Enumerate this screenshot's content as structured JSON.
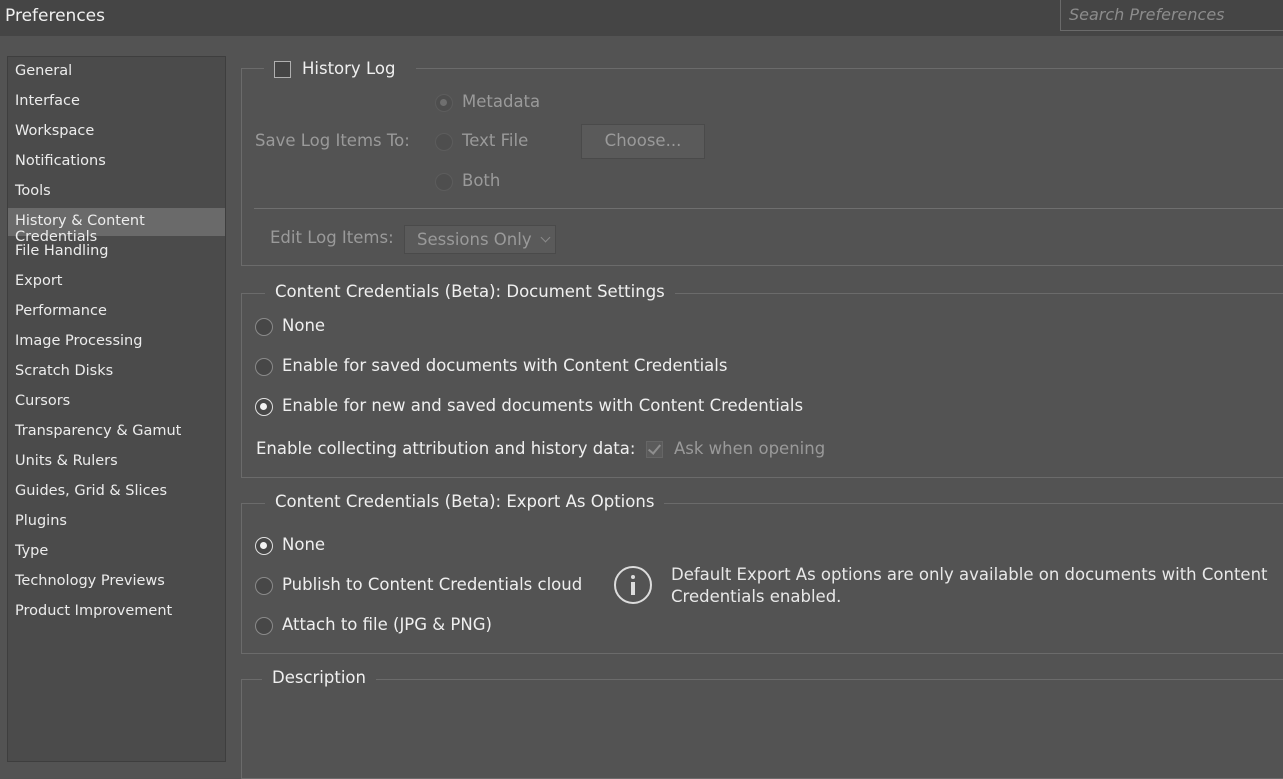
{
  "window": {
    "title": "Preferences"
  },
  "search": {
    "placeholder": "Search Preferences"
  },
  "sidebar": {
    "items": [
      {
        "label": "General"
      },
      {
        "label": "Interface"
      },
      {
        "label": "Workspace"
      },
      {
        "label": "Notifications"
      },
      {
        "label": "Tools"
      },
      {
        "label": "History & Content Credentials",
        "selected": true
      },
      {
        "label": "File Handling"
      },
      {
        "label": "Export"
      },
      {
        "label": "Performance"
      },
      {
        "label": "Image Processing"
      },
      {
        "label": "Scratch Disks"
      },
      {
        "label": "Cursors"
      },
      {
        "label": "Transparency & Gamut"
      },
      {
        "label": "Units & Rulers"
      },
      {
        "label": "Guides, Grid & Slices"
      },
      {
        "label": "Plugins"
      },
      {
        "label": "Type"
      },
      {
        "label": "Technology Previews"
      },
      {
        "label": "Product Improvement"
      }
    ]
  },
  "history_log": {
    "label": "History Log",
    "checked": false,
    "save_log_label": "Save Log Items To:",
    "save_options": [
      {
        "label": "Metadata",
        "selected": true
      },
      {
        "label": "Text File",
        "selected": false
      },
      {
        "label": "Both",
        "selected": false
      }
    ],
    "choose_button": "Choose...",
    "edit_log_label": "Edit Log Items:",
    "edit_log_value": "Sessions Only"
  },
  "doc_settings": {
    "legend": "Content Credentials (Beta): Document Settings",
    "options": [
      {
        "label": "None",
        "selected": false
      },
      {
        "label": "Enable for saved documents with Content Credentials",
        "selected": false
      },
      {
        "label": "Enable for new and saved documents with Content Credentials",
        "selected": true
      }
    ],
    "collect_label": "Enable collecting attribution and history data:",
    "ask_label": "Ask when opening",
    "ask_checked": true
  },
  "export_options": {
    "legend": "Content Credentials (Beta): Export As Options",
    "options": [
      {
        "label": "None",
        "selected": true
      },
      {
        "label": "Publish to Content Credentials cloud",
        "selected": false
      },
      {
        "label": "Attach to file (JPG & PNG)",
        "selected": false
      }
    ],
    "info_line1": "Default Export As options are only available on documents with Content",
    "info_line2": "Credentials enabled."
  },
  "description": {
    "legend": "Description"
  },
  "colors": {
    "background": "#535353",
    "titlebar": "#454545",
    "selected_item": "#6a6a6a"
  }
}
